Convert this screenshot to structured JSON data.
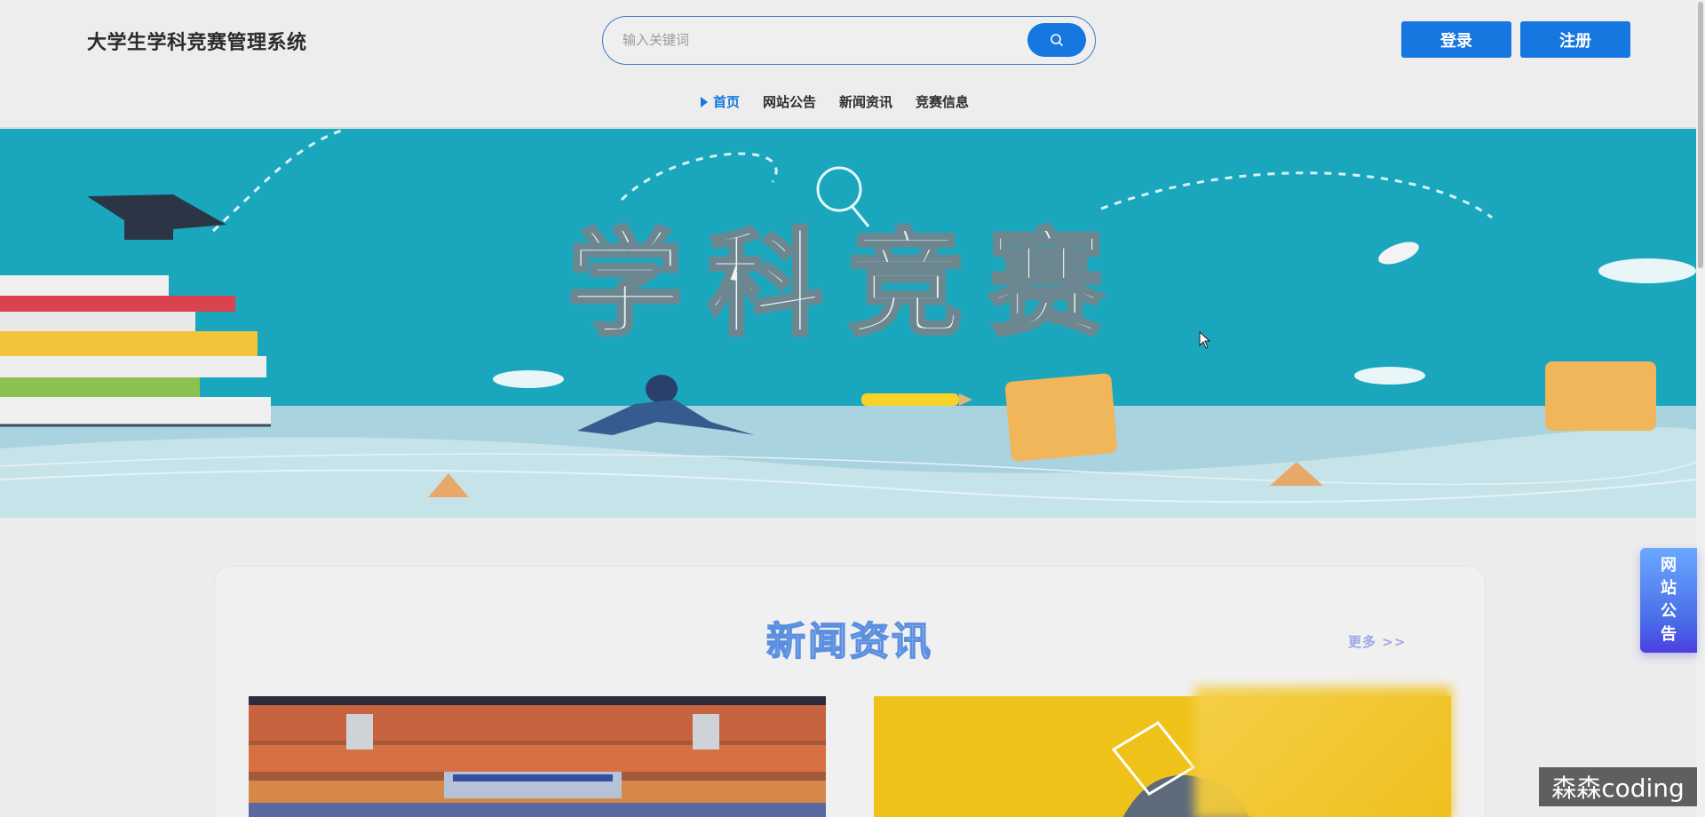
{
  "header": {
    "site_title": "大学生学科竞赛管理系统",
    "search_placeholder": "输入关键词",
    "login_label": "登录",
    "register_label": "注册"
  },
  "nav": {
    "items": [
      {
        "label": "首页",
        "active": true
      },
      {
        "label": "网站公告",
        "active": false
      },
      {
        "label": "新闻资讯",
        "active": false
      },
      {
        "label": "竞赛信息",
        "active": false
      }
    ]
  },
  "banner": {
    "headline": "学科竞赛"
  },
  "news_section": {
    "title": "新闻资讯",
    "more_label": "更多 >>"
  },
  "float_notice": {
    "chars": [
      "网",
      "站",
      "公",
      "告"
    ]
  },
  "watermark": "森森coding",
  "colors": {
    "accent": "#1677e0",
    "banner_sky": "#1aa7bd",
    "banner_ground": "#a9d3df"
  }
}
